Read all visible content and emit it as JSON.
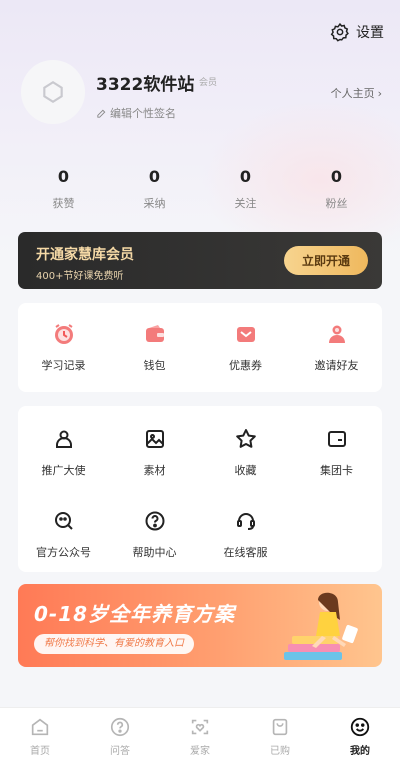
{
  "header": {
    "settings_label": "设置"
  },
  "profile": {
    "username": "3322软件站",
    "member_tag": "会员",
    "signature_hint": "编辑个性签名",
    "homepage_link": "个人主页",
    "homepage_arrow": "›"
  },
  "stats": [
    {
      "value": "0",
      "label": "获赞"
    },
    {
      "value": "0",
      "label": "采纳"
    },
    {
      "value": "0",
      "label": "关注"
    },
    {
      "value": "0",
      "label": "粉丝"
    }
  ],
  "vip": {
    "title": "开通家慧库会员",
    "subtitle": "400+节好课免费听",
    "button": "立即开通"
  },
  "quick_actions": [
    {
      "label": "学习记录",
      "icon": "clock-icon"
    },
    {
      "label": "钱包",
      "icon": "wallet-icon"
    },
    {
      "label": "优惠券",
      "icon": "coupon-icon"
    },
    {
      "label": "邀请好友",
      "icon": "invite-friend-icon"
    }
  ],
  "services": [
    {
      "label": "推广大使",
      "icon": "person-icon"
    },
    {
      "label": "素材",
      "icon": "image-icon"
    },
    {
      "label": "收藏",
      "icon": "star-icon"
    },
    {
      "label": "集团卡",
      "icon": "card-icon"
    },
    {
      "label": "官方公众号",
      "icon": "chat-bubble-icon"
    },
    {
      "label": "帮助中心",
      "icon": "help-icon"
    },
    {
      "label": "在线客服",
      "icon": "headset-icon"
    }
  ],
  "promo": {
    "title": "0-18岁全年养育方案",
    "subtitle": "帮你找到科学、有爱的教育入口"
  },
  "bottom_nav": [
    {
      "label": "首页",
      "icon": "home-icon",
      "active": false
    },
    {
      "label": "问答",
      "icon": "question-icon",
      "active": false
    },
    {
      "label": "爱家",
      "icon": "heart-home-icon",
      "active": false
    },
    {
      "label": "已购",
      "icon": "bag-icon",
      "active": false
    },
    {
      "label": "我的",
      "icon": "smile-icon",
      "active": true
    }
  ],
  "colors": {
    "vip_gold": "#f5d9a6",
    "vip_button": "#efb85d",
    "quick_icon_pink": "#f26d6d",
    "promo_orange": "#ff7a56"
  }
}
